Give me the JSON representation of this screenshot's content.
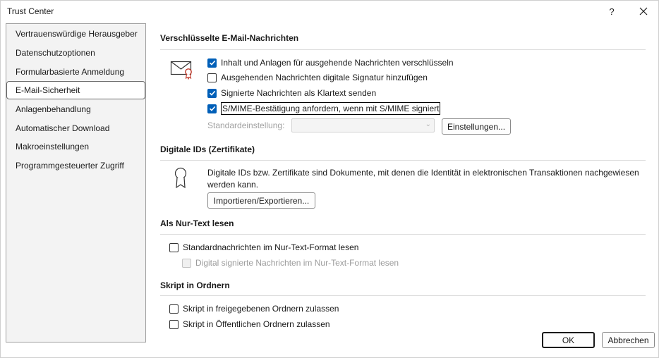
{
  "window": {
    "title": "Trust Center",
    "help_label": "?"
  },
  "sidebar": {
    "items": [
      {
        "label": "Vertrauenswürdige Herausgeber"
      },
      {
        "label": "Datenschutzoptionen"
      },
      {
        "label": "Formularbasierte Anmeldung"
      },
      {
        "label": "E-Mail-Sicherheit",
        "selected": true
      },
      {
        "label": "Anlagenbehandlung"
      },
      {
        "label": "Automatischer Download"
      },
      {
        "label": "Makroeinstellungen"
      },
      {
        "label": "Programmgesteuerter Zugriff"
      }
    ]
  },
  "encrypted": {
    "title": "Verschlüsselte E-Mail-Nachrichten",
    "icon": "envelope-certificate-icon",
    "options": [
      {
        "label": "Inhalt und Anlagen für ausgehende Nachrichten verschlüsseln",
        "checked": true
      },
      {
        "label": "Ausgehenden Nachrichten digitale Signatur hinzufügen",
        "checked": false
      },
      {
        "label": "Signierte Nachrichten als Klartext senden",
        "checked": true
      },
      {
        "label": "S/MIME-Bestätigung anfordern, wenn mit S/MIME signiert",
        "checked": true,
        "focused": true
      }
    ],
    "default_setting_label": "Standardeinstellung:",
    "default_setting_value": "",
    "settings_button": "Einstellungen..."
  },
  "digital_ids": {
    "title": "Digitale IDs (Zertifikate)",
    "icon": "certificate-ribbon-icon",
    "description": "Digitale IDs bzw. Zertifikate sind Dokumente, mit denen die Identität in elektronischen Transaktionen nachgewiesen werden kann.",
    "import_export_button": "Importieren/Exportieren..."
  },
  "plain_text": {
    "title": "Als Nur-Text lesen",
    "options": [
      {
        "label": "Standardnachrichten im Nur-Text-Format lesen",
        "checked": false,
        "disabled": false
      },
      {
        "label": "Digital signierte Nachrichten im Nur-Text-Format lesen",
        "checked": false,
        "disabled": true
      }
    ]
  },
  "script_folders": {
    "title": "Skript in Ordnern",
    "options": [
      {
        "label": "Skript in freigegebenen Ordnern zulassen",
        "checked": false
      },
      {
        "label": "Skript in Öffentlichen Ordnern zulassen",
        "checked": false
      }
    ]
  },
  "footer": {
    "ok_label": "OK",
    "cancel_label": "Abbrechen"
  },
  "colors": {
    "accent": "#005fb8",
    "sidebar_bg": "#f3f3f3"
  }
}
